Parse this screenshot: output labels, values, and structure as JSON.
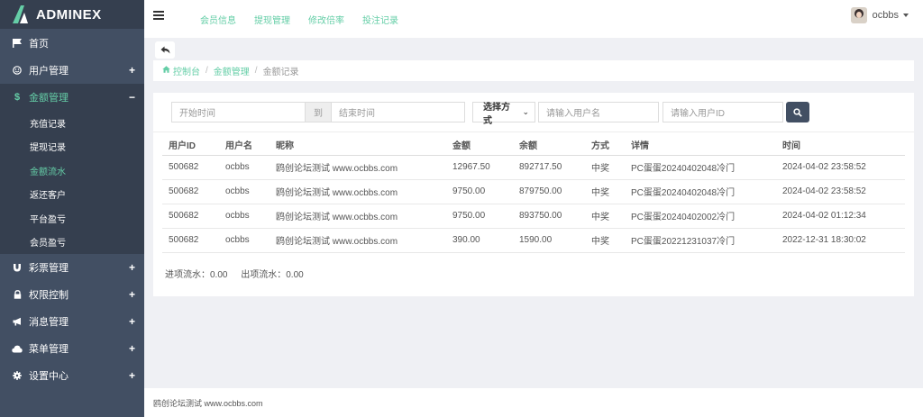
{
  "brand": {
    "name": "ADMINEX"
  },
  "sidebar": {
    "items": [
      {
        "label": "首页",
        "icon": "flag-icon",
        "toggle": ""
      },
      {
        "label": "用户管理",
        "icon": "smile-icon",
        "toggle": "+"
      },
      {
        "label": "金额管理",
        "icon": "dollar-icon",
        "toggle": "−"
      },
      {
        "label": "彩票管理",
        "icon": "magnet-icon",
        "toggle": "+"
      },
      {
        "label": "权限控制",
        "icon": "lock-icon",
        "toggle": "+"
      },
      {
        "label": "消息管理",
        "icon": "bullhorn-icon",
        "toggle": "+"
      },
      {
        "label": "菜单管理",
        "icon": "cloud-icon",
        "toggle": "+"
      },
      {
        "label": "设置中心",
        "icon": "gear-icon",
        "toggle": "+"
      }
    ],
    "subitems": [
      "充值记录",
      "提现记录",
      "金额流水",
      "返还客户",
      "平台盈亏",
      "会员盈亏"
    ]
  },
  "topbar": {
    "links": [
      "会员信息",
      "提现管理",
      "修改倍率",
      "投注记录"
    ],
    "username": "ocbbs"
  },
  "breadcrumb": {
    "home": "控制台",
    "section": "金额管理",
    "current": "金额记录"
  },
  "filters": {
    "start_placeholder": "开始时间",
    "to_label": "到",
    "end_placeholder": "结束时间",
    "method_select": "选择方式",
    "username_placeholder": "请输入用户名",
    "userid_placeholder": "请输入用户ID"
  },
  "table": {
    "headers": [
      "用户ID",
      "用户名",
      "昵称",
      "金额",
      "余额",
      "方式",
      "详情",
      "时间"
    ],
    "rows": [
      [
        "500682",
        "ocbbs",
        "鸥创论坛测试 www.ocbbs.com",
        "12967.50",
        "892717.50",
        "中奖",
        "PC蛋蛋20240402048冷门",
        "2024-04-02 23:58:52"
      ],
      [
        "500682",
        "ocbbs",
        "鸥创论坛测试 www.ocbbs.com",
        "9750.00",
        "879750.00",
        "中奖",
        "PC蛋蛋20240402048冷门",
        "2024-04-02 23:58:52"
      ],
      [
        "500682",
        "ocbbs",
        "鸥创论坛测试 www.ocbbs.com",
        "9750.00",
        "893750.00",
        "中奖",
        "PC蛋蛋20240402002冷门",
        "2024-04-02 01:12:34"
      ],
      [
        "500682",
        "ocbbs",
        "鸥创论坛测试 www.ocbbs.com",
        "390.00",
        "1590.00",
        "中奖",
        "PC蛋蛋20221231037冷门",
        "2022-12-31 18:30:02"
      ]
    ]
  },
  "summary": {
    "income": "进项流水：0.00",
    "outgo": "出项流水：0.00"
  },
  "footer": {
    "text": "鸥创论坛测试 www.ocbbs.com"
  },
  "colors": {
    "sidebar": "#424f63",
    "sidebar_dark": "#353f4f",
    "accent": "#65cea7"
  }
}
